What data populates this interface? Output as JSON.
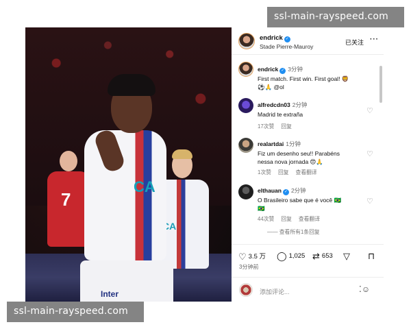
{
  "watermark": {
    "text": "ssl-main-rayspeed.com"
  },
  "photo": {
    "jersey_sponsor": "CA",
    "shorts_sponsor": "Inter",
    "back_number": "7",
    "next_icon": "chevron-right-icon",
    "dots_total": 9,
    "dot_active": 1
  },
  "post": {
    "author": "endrick",
    "location": "Stade Pierre-Mauroy",
    "follow_label": "已关注",
    "more_icon": "ellipsis-icon",
    "caption_author": "endrick",
    "caption_time": "3分钟",
    "caption_line1": "First match. First win. First goal! 🦁",
    "caption_line2": "⚽️🙏 @ol"
  },
  "comments": [
    {
      "user": "alfredcdn03",
      "time": "2分钟",
      "text": [
        "Madrid te extraña"
      ],
      "likes": "17次赞",
      "reply": "回复",
      "view_replies": ""
    },
    {
      "user": "realartdai",
      "time": "1分钟",
      "text": [
        "Fiz um desenho seu!! Parabéns",
        "nessa nova jornada 😍🙏"
      ],
      "likes": "1次赞",
      "reply": "回复",
      "view_replies": "查看翻译"
    },
    {
      "user": "elthauan",
      "time": "2分钟",
      "verified": true,
      "text": [
        "O Brasileiro sabe que é você 🇧🇷",
        "🇧🇷"
      ],
      "likes": "44次赞",
      "reply": "回复",
      "view_replies": "查看翻译"
    }
  ],
  "view_all": "—— 查看所有1条回复",
  "actions": {
    "likes": "3.5 万",
    "comments": "1,025",
    "reposts": "653",
    "icons": [
      "heart-icon",
      "comment-icon",
      "repost-icon",
      "share-icon",
      "bookmark-icon"
    ]
  },
  "posted_ago": "3分钟前",
  "composer": {
    "placeholder": "添加评论..."
  }
}
